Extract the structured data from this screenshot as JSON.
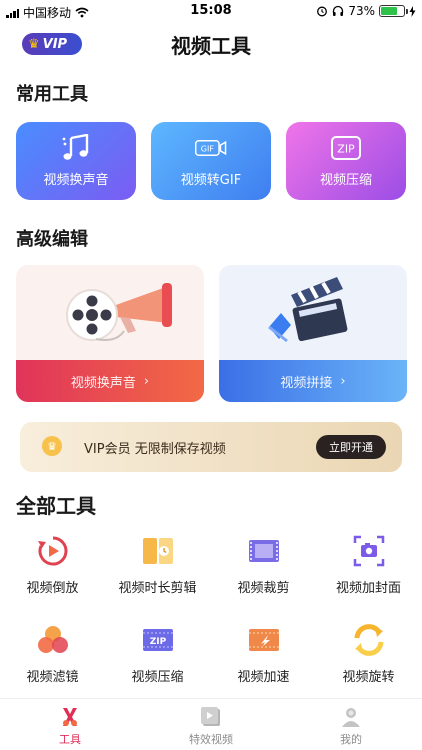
{
  "status": {
    "carrier": "中国移动",
    "time": "15:08",
    "battery": "73%",
    "battery_level": 0.73
  },
  "nav": {
    "vip_logo": "VIP",
    "title": "视频工具"
  },
  "common": {
    "title": "常用工具",
    "items": [
      {
        "label": "视频换声音",
        "icon": "music-note-icon"
      },
      {
        "label": "视频转GIF",
        "icon": "gif-icon"
      },
      {
        "label": "视频压缩",
        "icon": "zip-icon"
      }
    ]
  },
  "advanced": {
    "title": "高级编辑",
    "items": [
      {
        "label": "视频换声音",
        "icon": "film-reel-megaphone-icon"
      },
      {
        "label": "视频拼接",
        "icon": "clapperboard-icon"
      }
    ]
  },
  "vip_banner": {
    "text": "VIP会员 无限制保存视频",
    "button": "立即开通"
  },
  "all_tools": {
    "title": "全部工具",
    "items": [
      {
        "label": "视频倒放",
        "icon": "reverse-play-icon"
      },
      {
        "label": "视频时长剪辑",
        "icon": "duration-trim-icon"
      },
      {
        "label": "视频裁剪",
        "icon": "crop-icon"
      },
      {
        "label": "视频加封面",
        "icon": "add-cover-icon"
      },
      {
        "label": "视频滤镜",
        "icon": "filter-icon"
      },
      {
        "label": "视频压缩",
        "icon": "compress-icon"
      },
      {
        "label": "视频加速",
        "icon": "speed-up-icon"
      },
      {
        "label": "视频旋转",
        "icon": "rotate-icon"
      }
    ]
  },
  "tabs": [
    {
      "label": "工具",
      "icon": "tools-icon",
      "active": true
    },
    {
      "label": "特效视频",
      "icon": "effects-video-icon",
      "active": false
    },
    {
      "label": "我的",
      "icon": "profile-icon",
      "active": false
    }
  ],
  "colors": {
    "accent": "#e02e56",
    "common_1": "#5a7dfb",
    "common_2": "#4e9cf7",
    "common_3": "#c65ae9",
    "vip_banner_bg": "#f3e5c9"
  }
}
